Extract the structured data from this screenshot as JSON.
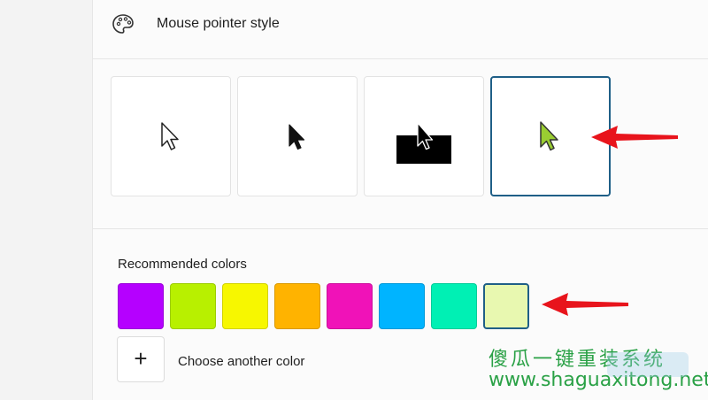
{
  "header": {
    "label": "Mouse pointer style",
    "icon": "palette-icon"
  },
  "pointer_styles": [
    {
      "name": "white",
      "icon": "white-cursor-icon",
      "selected": false
    },
    {
      "name": "black",
      "icon": "black-cursor-icon",
      "selected": false
    },
    {
      "name": "inverted",
      "icon": "inverted-cursor-icon",
      "selected": false
    },
    {
      "name": "custom",
      "icon": "custom-color-cursor-icon",
      "selected": true,
      "cursor_color": "#9acd32"
    }
  ],
  "recommended": {
    "label": "Recommended colors",
    "swatches": [
      "#b500ff",
      "#b8f000",
      "#f7f700",
      "#ffb300",
      "#f012b8",
      "#00b4ff",
      "#00f0b4",
      "#e8f8b0"
    ],
    "selected_index": 7
  },
  "choose_color": {
    "label": "Choose another color",
    "icon": "plus-icon",
    "glyph": "+"
  },
  "annotations": {
    "arrow_color": "#e8141c"
  },
  "watermark": {
    "line1": "傻瓜一键重装系统",
    "line2": "www.shaguaxitong.net"
  }
}
